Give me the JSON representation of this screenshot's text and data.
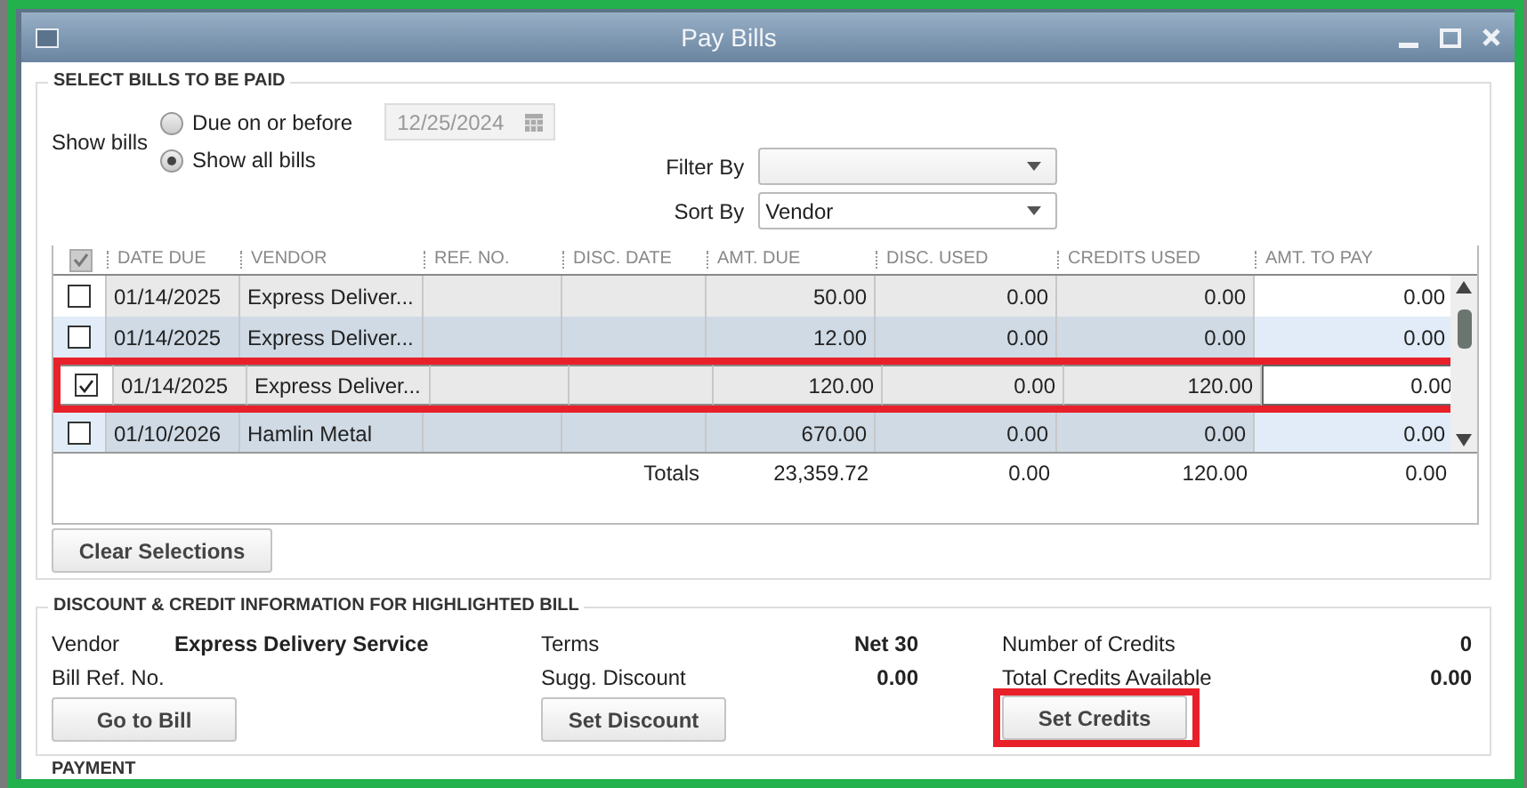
{
  "window": {
    "title": "Pay Bills"
  },
  "select_section": {
    "title": "SELECT BILLS TO BE PAID",
    "show_bills_label": "Show bills",
    "options": [
      {
        "label": "Due on or before",
        "selected": false
      },
      {
        "label": "Show all bills",
        "selected": true
      }
    ],
    "date_field": {
      "value": "12/25/2024",
      "disabled": true
    },
    "filter_by": {
      "label": "Filter By"
    },
    "sort_by": {
      "label": "Sort By",
      "value": "Vendor"
    }
  },
  "table": {
    "header_checked": true,
    "columns": [
      "DATE DUE",
      "VENDOR",
      "REF. NO.",
      "DISC. DATE",
      "AMT. DUE",
      "DISC. USED",
      "CREDITS USED",
      "AMT. TO PAY"
    ],
    "rows": [
      {
        "checked": false,
        "highlighted": false,
        "annotated": false,
        "date_due": "01/14/2025",
        "vendor": "Express Deliver...",
        "amt_due": "50.00",
        "disc_used": "0.00",
        "credits_used": "0.00",
        "amt_to_pay": "0.00"
      },
      {
        "checked": false,
        "highlighted": false,
        "annotated": false,
        "date_due": "01/14/2025",
        "vendor": "Express Deliver...",
        "amt_due": "12.00",
        "disc_used": "0.00",
        "credits_used": "0.00",
        "amt_to_pay": "0.00"
      },
      {
        "checked": true,
        "highlighted": true,
        "annotated": true,
        "date_due": "01/14/2025",
        "vendor": "Express Deliver...",
        "amt_due": "120.00",
        "disc_used": "0.00",
        "credits_used": "120.00",
        "amt_to_pay": "0.00"
      },
      {
        "checked": false,
        "highlighted": false,
        "annotated": false,
        "date_due": "01/10/2026",
        "vendor": "Hamlin Metal",
        "amt_due": "670.00",
        "disc_used": "0.00",
        "credits_used": "0.00",
        "amt_to_pay": "0.00"
      }
    ],
    "totals": {
      "label": "Totals",
      "amt_due": "23,359.72",
      "disc_used": "0.00",
      "credits_used": "120.00",
      "amt_to_pay": "0.00"
    }
  },
  "clear_button": {
    "label": "Clear Selections"
  },
  "info_section": {
    "title": "DISCOUNT & CREDIT INFORMATION FOR HIGHLIGHTED BILL",
    "groups": [
      {
        "fields": [
          {
            "label": "Vendor",
            "value": "Express Delivery Service"
          },
          {
            "label": "Bill Ref. No."
          }
        ],
        "button": {
          "label": "Go to Bill",
          "annotated": false
        }
      },
      {
        "fields": [
          {
            "label": "Terms",
            "value": "Net 30"
          },
          {
            "label": "Sugg. Discount",
            "value": "0.00"
          }
        ],
        "button": {
          "label": "Set Discount",
          "annotated": false
        }
      },
      {
        "fields": [
          {
            "label": "Number of Credits",
            "value": "0"
          },
          {
            "label": "Total Credits Available",
            "value": "0.00"
          }
        ],
        "button": {
          "label": "Set Credits",
          "annotated": true
        }
      }
    ]
  },
  "payment_section": {
    "title": "PAYMENT"
  }
}
